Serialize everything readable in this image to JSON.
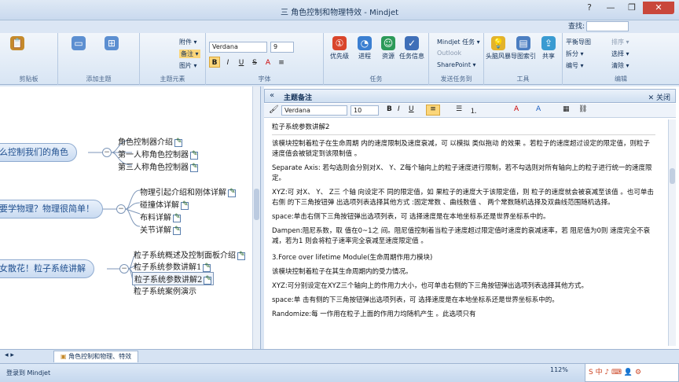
{
  "window": {
    "title": "三 角色控制和物理特效 - Mindjet",
    "find_label": "查找:"
  },
  "ribbon": {
    "clipboard": {
      "label": "剪贴板"
    },
    "add_topic": {
      "label": "添加主题"
    },
    "topic_elements": {
      "label": "主题元素",
      "items": [
        "附件 ▾",
        "备注 ▾",
        "图片 ▾"
      ]
    },
    "font": {
      "label": "字体",
      "family": "Verdana",
      "size": "9"
    },
    "tasks": {
      "label": "任务",
      "buttons": [
        "优先级",
        "进程",
        "资源",
        "任务信息"
      ]
    },
    "send": {
      "label": "发送任务到",
      "items": [
        "Mindjet 任务 ▾",
        "Outlook",
        "SharePoint ▾"
      ]
    },
    "tools": {
      "label": "工具",
      "buttons": [
        "头脑风暴",
        "导图索引",
        "共享"
      ]
    },
    "edit": {
      "label": "编辑",
      "items": [
        "平衡导图",
        "拆分 ▾",
        "编号 ▾",
        "排序 ▾",
        "选择 ▾",
        "清除 ▾"
      ]
    }
  },
  "map": {
    "topics": [
      {
        "label": "么控制我们的角色",
        "subs": [
          "角色控制器介绍",
          "第一人称角色控制器",
          "第三人称角色控制器"
        ]
      },
      {
        "label": "要学物理？物理很简单！",
        "subs": [
          "物理引起介绍和刚体详解",
          "碰撞体详解",
          "布料详解",
          "关节详解"
        ]
      },
      {
        "label": "女散花！粒子系统讲解",
        "subs": [
          "粒子系统概述及控制面板介绍",
          "粒子系统参数讲解1",
          "粒子系统参数讲解2",
          "粒子系统案例演示"
        ]
      }
    ]
  },
  "notes": {
    "header": "主题备注",
    "close_label": "关闭",
    "font_family": "Verdana",
    "font_size": "10",
    "title": "粒子系统参数讲解2",
    "paragraphs": [
      "该模块控制着粒子在生命周期 内的速度限制及速度衰减，可 以模拟 类似拖动 的效果 。若粒子的速度超过设定的限定值，则粒子速度值会被锁定到该限制值 。",
      "Separate Axis: 若勾选则会分别对X、 Y、Z每个轴向上的粒子速度进行限制，若不勾选则对所有轴向上的粒子进行统一的速度限定。",
      "XYZ:可 对X、 Y、 Z三 个轴 向设定不 同的限定值，如 果粒子的速度大于该限定值，则 粒子的速度就会被衰减至该值 。也可单击右侧 的下三角按钮弹 出选项列表选择其他方式 :固定常数 、曲线数值 、 两个常数随机选择及双曲线范围随机选择。",
      "space:单击右侧下三角按钮弹出选项列表，可 选择速度是在本地坐标系还是世界坐标系中的。",
      "Dampen:阻尼系数，取 值在0~1之 间。阻尼值控制着当粒子速度超过限定值时速度的衰减速率，若 阻尼值为0则 速度完全不衰减，若为1 则会将粒子速率完全衰减至速度限定值 。",
      "3.Force over lifetime Module(生命周期作用力模块)",
      "该模块控制着粒子在其生命周期内的受力情况。",
      "XYZ:可分别设定在XYZ三个轴向上的作用力大小，也可单击右侧的下三角按钮弹出选项列表选择其他方式。",
      "space:单 击有侧的下三角按钮弹出选项列表，可 选择速度是在本地坐标系还是世界坐标系中的。",
      "Randomize:每 一作用在粒子上面的作用力均随机产生 。此选项只有"
    ]
  },
  "tabs": {
    "active": "角色控制和物理、特效"
  },
  "status": {
    "login": "登录到 Mindjet",
    "zoom": "112%"
  },
  "ime": {
    "label": "S 中 ♪ ⌨ 👤 ⚙"
  }
}
